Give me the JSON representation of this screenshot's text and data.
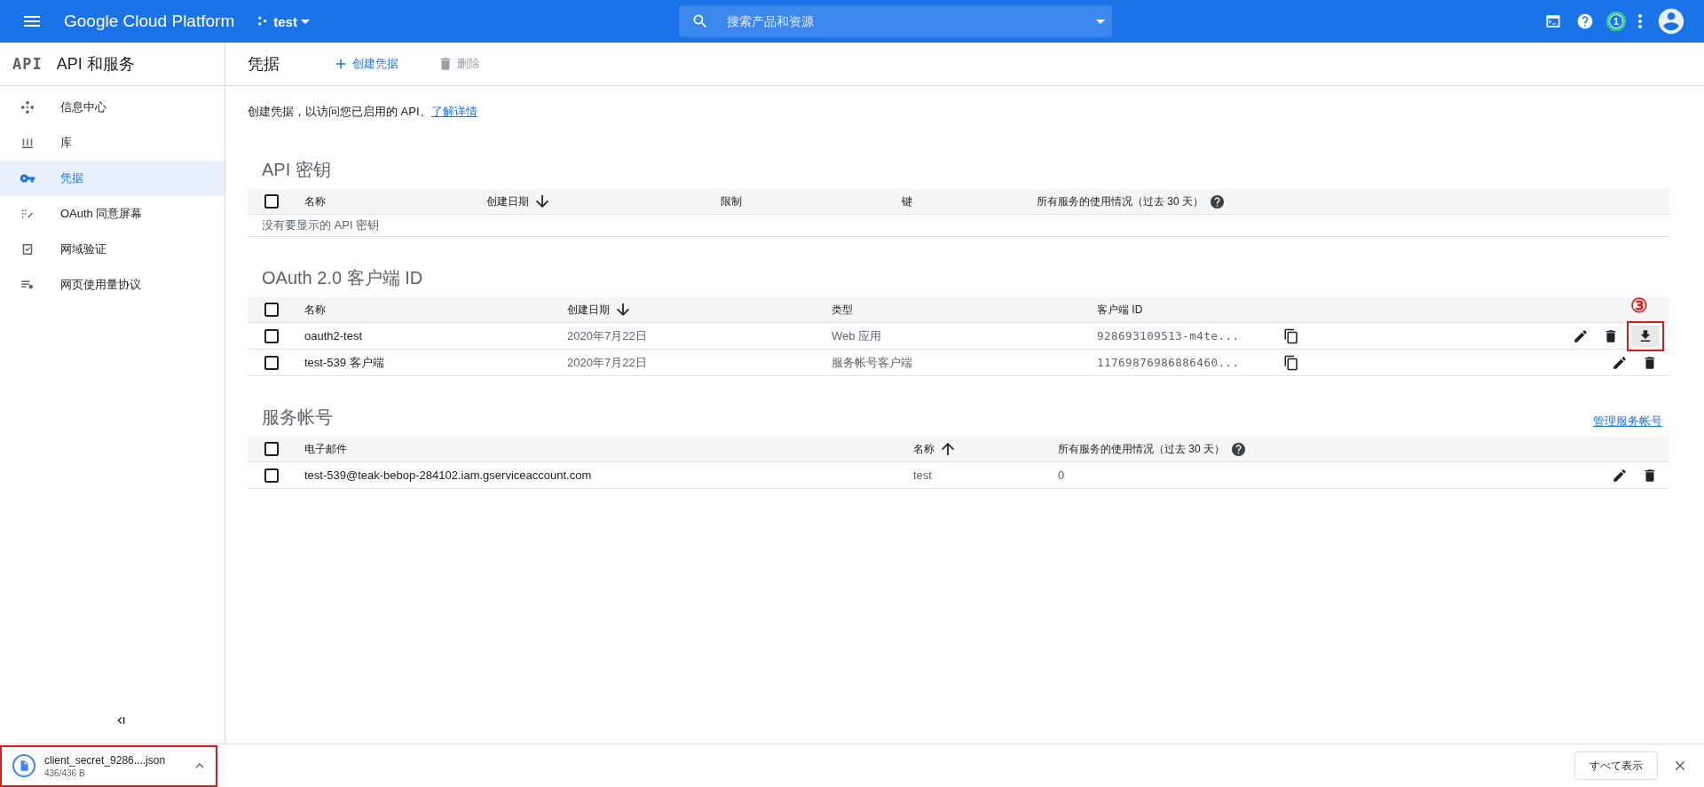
{
  "topbar": {
    "product": "Google Cloud Platform",
    "project": "test",
    "search": {
      "placeholder": "搜索产品和资源"
    },
    "notifications": "1"
  },
  "sidebar": {
    "logo": "API",
    "title": "API 和服务",
    "items": [
      {
        "label": "信息中心",
        "kind": "dashboard",
        "selected": false
      },
      {
        "label": "库",
        "kind": "library",
        "selected": false
      },
      {
        "label": "凭据",
        "kind": "key",
        "selected": true
      },
      {
        "label": "OAuth 同意屏幕",
        "kind": "consent",
        "selected": false
      },
      {
        "label": "网域验证",
        "kind": "verify",
        "selected": false
      },
      {
        "label": "网页使用量协议",
        "kind": "agreement",
        "selected": false
      }
    ]
  },
  "header": {
    "title": "凭据",
    "actions": [
      {
        "label": "创建凭据",
        "kind": "add",
        "disabled": false
      },
      {
        "label": "删除",
        "kind": "delete",
        "disabled": true
      }
    ]
  },
  "intro": {
    "text": "创建凭据，以访问您已启用的 API。",
    "link": "了解详情"
  },
  "sections": [
    {
      "title": "API 密钥",
      "columns": [
        {
          "label": "名称"
        },
        {
          "label": "创建日期",
          "sorted": true,
          "descending": true
        },
        {
          "label": "限制"
        },
        {
          "label": "键"
        },
        {
          "label": "所有服务的使用情况（过去 30 天）",
          "help": true
        }
      ],
      "header_checked": false,
      "empty": "没有要显示的 API 密钥"
    },
    {
      "title": "OAuth 2.0 客户端 ID",
      "columns": [
        {
          "label": "名称"
        },
        {
          "label": "创建日期",
          "sorted": true,
          "descending": true
        },
        {
          "label": "类型"
        },
        {
          "label": "客户端 ID"
        }
      ],
      "header_checked": false,
      "rows": [
        {
          "checked": false,
          "cells": [
            "oauth2-test",
            "2020年7月22日",
            "Web 应用",
            "928693109513-m4te..."
          ],
          "copy": true,
          "actions": [
            {
              "kind": "edit"
            },
            {
              "kind": "delete"
            },
            {
              "kind": "download",
              "hovered": true,
              "annotation": "③"
            }
          ]
        },
        {
          "checked": false,
          "cells": [
            "test-539 客户端",
            "2020年7月22日",
            "服务帐号客户端",
            "11769876986886460..."
          ],
          "copy": true,
          "actions": [
            {
              "kind": "edit"
            },
            {
              "kind": "delete"
            }
          ]
        }
      ]
    },
    {
      "title": "服务帐号",
      "link": "管理服务帐号",
      "columns": [
        {
          "label": "电子邮件"
        },
        {
          "label": "名称",
          "sorted": true,
          "descending": false
        },
        {
          "label": "所有服务的使用情况（过去 30 天）",
          "help": true
        }
      ],
      "header_checked": false,
      "rows": [
        {
          "checked": false,
          "cells": [
            "test-539@teak-bebop-284102.iam.gserviceaccount.com",
            "test",
            "0"
          ],
          "actions": [
            {
              "kind": "edit"
            },
            {
              "kind": "delete"
            }
          ]
        }
      ]
    }
  ],
  "download_bar": {
    "file": "client_secret_9286....json",
    "size": "436/436 B",
    "annotated": true,
    "show_all": "すべて表示"
  }
}
